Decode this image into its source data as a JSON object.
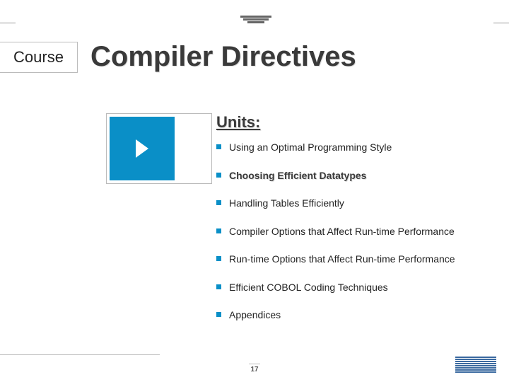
{
  "course_label": "Course",
  "title": "Compiler Directives",
  "units_heading": "Units:",
  "units": [
    {
      "label": "Using an Optimal Programming Style",
      "current": false
    },
    {
      "label": "Choosing Efficient Datatypes",
      "current": true
    },
    {
      "label": "Handling Tables Efficiently",
      "current": false
    },
    {
      "label": "Compiler Options that Affect Run-time Performance",
      "current": false
    },
    {
      "label": "Run-time Options that Affect Run-time Performance",
      "current": false
    },
    {
      "label": "Efficient COBOL Coding Techniques",
      "current": false
    },
    {
      "label": "Appendices",
      "current": false
    }
  ],
  "page_number": "17",
  "logo_name": "IBM"
}
